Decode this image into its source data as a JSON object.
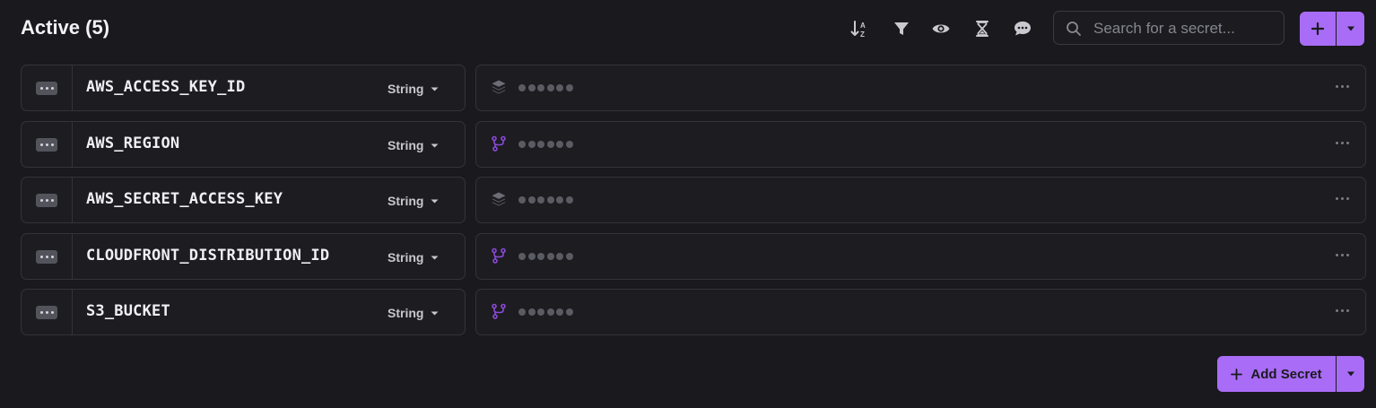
{
  "header": {
    "title": "Active (5)"
  },
  "toolbar": {
    "icons": [
      "sort-az-icon",
      "filter-icon",
      "eye-icon",
      "hourglass-icon",
      "comment-icon"
    ]
  },
  "search": {
    "placeholder": "Search for a secret..."
  },
  "secrets": [
    {
      "key": "AWS_ACCESS_KEY_ID",
      "type": "String",
      "source_icon": "layers-icon",
      "masked": "●●●●●●"
    },
    {
      "key": "AWS_REGION",
      "type": "String",
      "source_icon": "branch-icon",
      "masked": "●●●●●●"
    },
    {
      "key": "AWS_SECRET_ACCESS_KEY",
      "type": "String",
      "source_icon": "layers-icon",
      "masked": "●●●●●●"
    },
    {
      "key": "CLOUDFRONT_DISTRIBUTION_ID",
      "type": "String",
      "source_icon": "branch-icon",
      "masked": "●●●●●●"
    },
    {
      "key": "S3_BUCKET",
      "type": "String",
      "source_icon": "branch-icon",
      "masked": "●●●●●●"
    }
  ],
  "footer": {
    "add_secret_label": "Add Secret"
  },
  "colors": {
    "background": "#19191e",
    "accent": "#a96cf6",
    "branch_icon": "#8b4ad8",
    "layers_icon": "#6d6d76"
  }
}
